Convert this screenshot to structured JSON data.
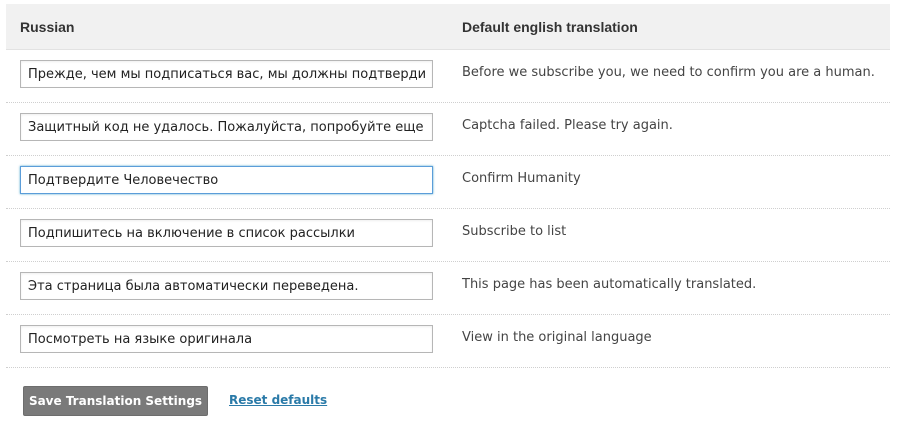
{
  "table": {
    "headers": {
      "source_language": "Russian",
      "default_translation": "Default english translation"
    },
    "rows": [
      {
        "russian_value": "Прежде, чем мы подписаться вас, мы должны подтвердить, что вы человек.",
        "english": "Before we subscribe you, we need to confirm you are a human."
      },
      {
        "russian_value": "Защитный код не удалось. Пожалуйста, попробуйте еще раз.",
        "english": "Captcha failed. Please try again."
      },
      {
        "russian_value": "Подтвердите Человечество",
        "english": "Confirm Humanity",
        "focused": true
      },
      {
        "russian_value": "Подпишитесь на включение в список рассылки",
        "english": "Subscribe to list"
      },
      {
        "russian_value": "Эта страница была автоматически переведена.",
        "english": "This page has been automatically translated."
      },
      {
        "russian_value": "Посмотреть на языке оригинала",
        "english": "View in the original language"
      }
    ]
  },
  "actions": {
    "save_label": "Save Translation Settings",
    "reset_label": "Reset defaults"
  },
  "colors": {
    "header_bg": "#f1f1f1",
    "button_bg": "#7a7a7a",
    "link": "#2a7aa8",
    "focus_border": "#5b9dd9"
  }
}
